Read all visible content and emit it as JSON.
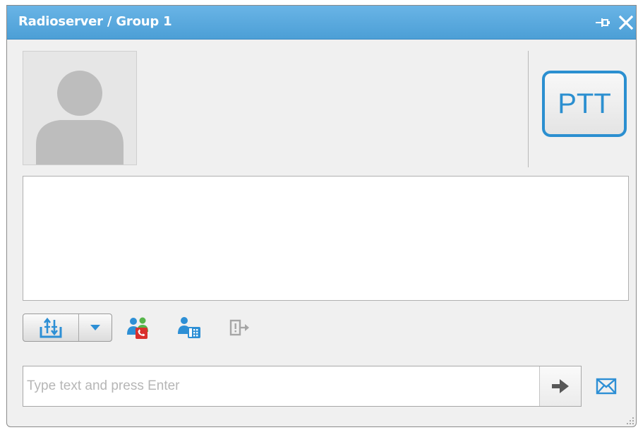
{
  "window": {
    "title": "Radioserver / Group 1",
    "accent_color": "#4c9fd6"
  },
  "titlebar": {
    "icons": [
      "pin-icon",
      "close-icon"
    ]
  },
  "avatar": {
    "icon": "user-silhouette-icon"
  },
  "ptt": {
    "label": "PTT",
    "color": "#2b8fd0"
  },
  "toolbar": {
    "items": [
      "transfer-channel-icon",
      "dropdown-arrow-icon",
      "group-call-icon",
      "user-phone-icon",
      "exit-icon"
    ]
  },
  "message_input": {
    "placeholder": "Type text and press Enter",
    "value": ""
  },
  "send": {
    "icon": "arrow-right-icon"
  },
  "message": {
    "icon": "envelope-icon"
  }
}
